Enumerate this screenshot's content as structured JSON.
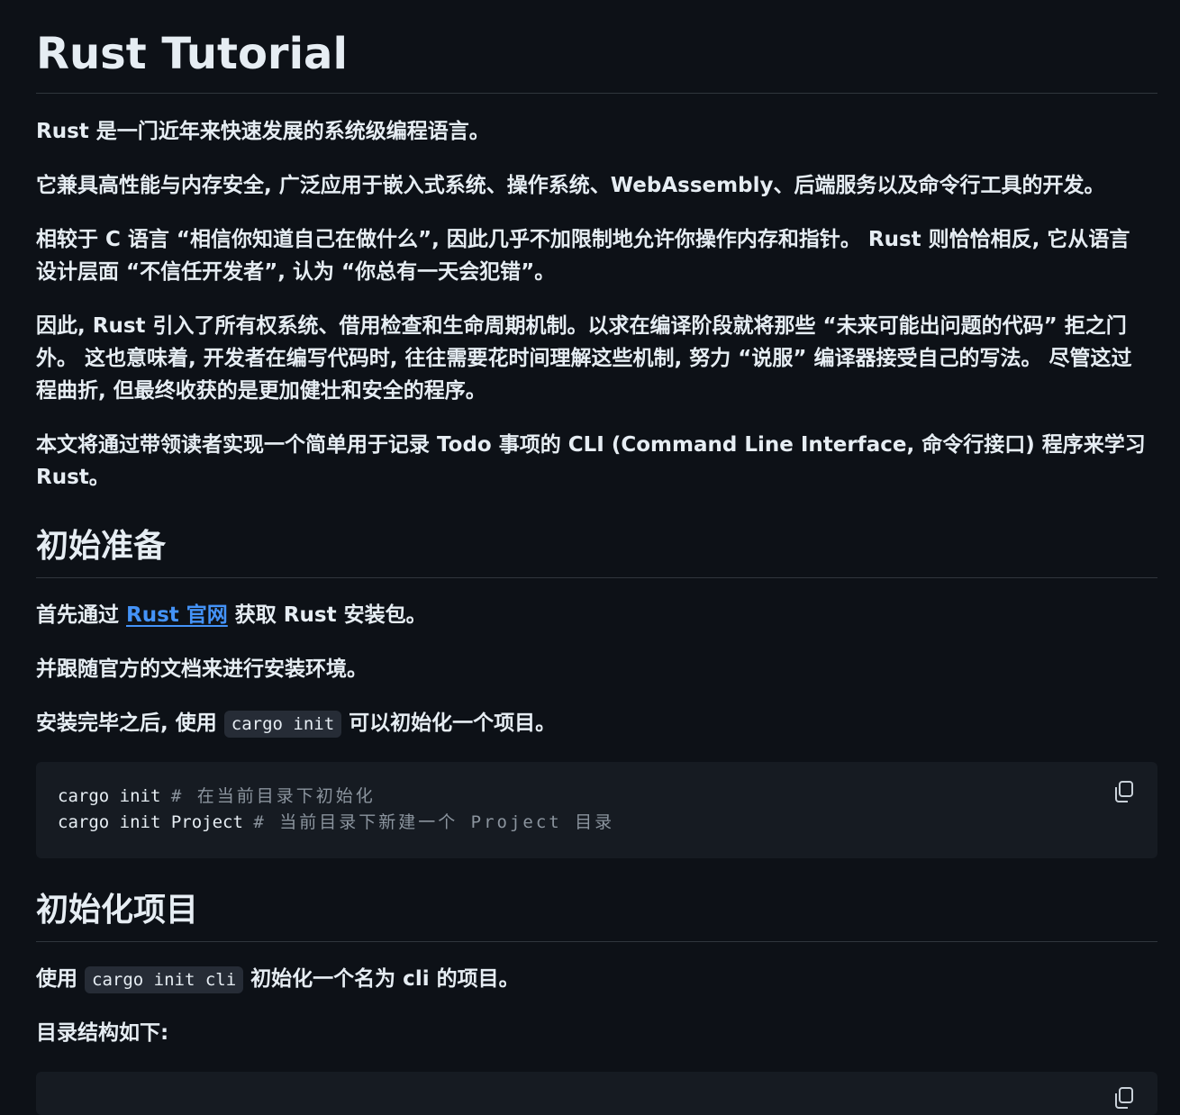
{
  "page": {
    "title": "Rust Tutorial"
  },
  "intro": {
    "p1": "Rust 是一门近年来快速发展的系统级编程语言。",
    "p2": "它兼具高性能与内存安全, 广泛应用于嵌入式系统、操作系统、WebAssembly、后端服务以及命令行工具的开发。",
    "p3_line1": "相较于 C 语言 “相信你知道自己在做什么”, 因此几乎不加限制地允许你操作内存和指针。 Rust 则恰恰相反, 它从语言",
    "p3_line2": "设计层面 “不信任开发者”, 认为 “你总有一天会犯错”。",
    "p4_line1": "因此, Rust 引入了所有权系统、借用检查和生命周期机制。以求在编译阶段就将那些 “未来可能出问题的代码” 拒之门",
    "p4_line2": "外。 这也意味着, 开发者在编写代码时, 往往需要花时间理解这些机制, 努力 “说服” 编译器接受自己的写法。 尽管这过",
    "p4_line3": "程曲折, 但最终收获的是更加健壮和安全的程序。",
    "p5_line1": "本文将通过带领读者实现一个简单用于记录 Todo 事项的 CLI (Command Line Interface, 命令行接口) 程序来学习",
    "p5_line2": "Rust。"
  },
  "section1": {
    "heading": "初始准备",
    "p1_before": "首先通过 ",
    "p1_link": "Rust 官网",
    "p1_after": " 获取 Rust 安装包。",
    "p2": "并跟随官方的文档来进行安装环境。",
    "p3_before": "安装完毕之后, 使用 ",
    "p3_code": "cargo init",
    "p3_after": " 可以初始化一个项目。",
    "code_block": {
      "line1_cmd": "cargo init ",
      "line1_comment": "# 在当前目录下初始化",
      "line2_cmd": "cargo init Project ",
      "line2_comment": "# 当前目录下新建一个 Project 目录"
    }
  },
  "section2": {
    "heading": "初始化项目",
    "p1_before": "使用 ",
    "p1_code": "cargo init cli",
    "p1_after": " 初始化一个名为 cli 的项目。",
    "p2": "目录结构如下:"
  },
  "icons": {
    "copy": "copy-icon"
  },
  "colors": {
    "background": "#0d1117",
    "text": "#e6edf3",
    "link": "#4493f8",
    "code_bg": "#161b22",
    "comment": "#8b949e"
  }
}
